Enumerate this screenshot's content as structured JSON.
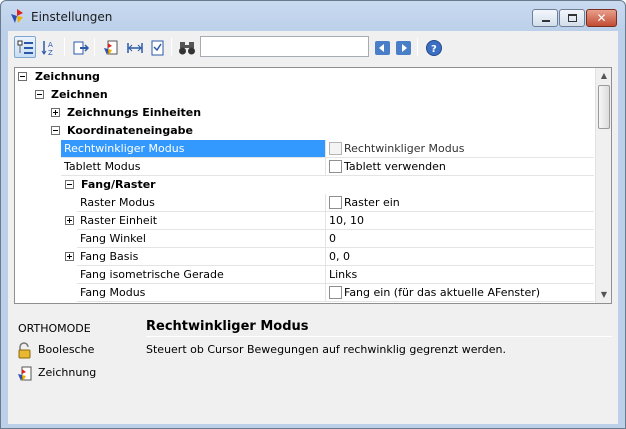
{
  "window": {
    "title": "Einstellungen",
    "icons": {
      "app": "acad-app-icon"
    }
  },
  "toolbar": {
    "search_value": "",
    "buttons": [
      {
        "name": "categorized-view-icon",
        "active": true
      },
      {
        "name": "alphabetical-sort-icon",
        "label": "A Z"
      },
      {
        "name": "export-icon"
      },
      {
        "name": "drawing-settings-icon"
      },
      {
        "name": "column-width-icon"
      },
      {
        "name": "checklist-icon"
      },
      {
        "name": "binoculars-icon"
      },
      {
        "name": "previous-arrow-icon"
      },
      {
        "name": "next-arrow-icon"
      },
      {
        "name": "help-icon",
        "label": "?"
      }
    ]
  },
  "tree": {
    "cat_zeichnung": "Zeichnung",
    "cat_zeichnen": "Zeichnen",
    "cat_einheiten": "Zeichnungs Einheiten",
    "cat_koordinaten": "Koordinateneingabe",
    "cat_fang": "Fang/Raster",
    "props": {
      "ortho_name": "Rechtwinkliger Modus",
      "ortho_value": "Rechtwinkliger Modus",
      "tablett_name": "Tablett Modus",
      "tablett_value": "Tablett verwenden",
      "raster_modus_name": "Raster Modus",
      "raster_modus_value": "Raster ein",
      "raster_einheit_name": "Raster Einheit",
      "raster_einheit_value": "10, 10",
      "fang_winkel_name": "Fang Winkel",
      "fang_winkel_value": "0",
      "fang_basis_name": "Fang Basis",
      "fang_basis_value": "0, 0",
      "fang_iso_name": "Fang isometrische Gerade",
      "fang_iso_value": "Links",
      "fang_modus_name": "Fang Modus",
      "fang_modus_value": "Fang ein (für das aktuelle AFenster)"
    }
  },
  "info": {
    "variable": "ORTHOMODE",
    "type": "Boolesche",
    "section": "Zeichnung",
    "title": "Rechtwinkliger Modus",
    "description": "Steuert ob Cursor Bewegungen auf rechwinklig gegrenzt werden."
  },
  "colors": {
    "selection": "#3399ff",
    "titlebar": "#c9daf0",
    "close_button": "#c24b33"
  }
}
